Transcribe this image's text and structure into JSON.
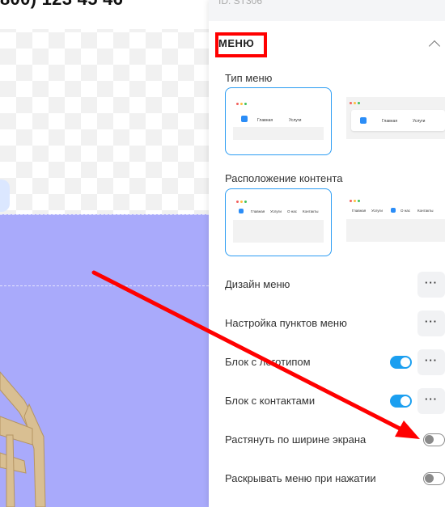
{
  "canvas": {
    "phone": "800) 123 45 46"
  },
  "panel": {
    "id_text": "ID: ST306",
    "section_title": "МЕНЮ",
    "menu_type_label": "Тип меню",
    "content_position_label": "Расположение контента",
    "thumb_menu_a": {
      "nav": [
        "Главная",
        "Услуги"
      ]
    },
    "thumb_menu_b": {
      "nav": [
        "Главная",
        "Услуги"
      ]
    },
    "thumb_content_a": {
      "nav": [
        "Главная",
        "Услуги",
        "О нас",
        "Контакты"
      ]
    },
    "thumb_content_b": {
      "nav": [
        "Главная",
        "Услуги",
        "О нас",
        "Контакты"
      ]
    },
    "rows": [
      {
        "label": "Дизайн меню",
        "control": "more"
      },
      {
        "label": "Настройка пунктов меню",
        "control": "more"
      },
      {
        "label": "Блок с логотипом",
        "control": "toggle-more",
        "enabled": true
      },
      {
        "label": "Блок с контактами",
        "control": "toggle-more",
        "enabled": true
      },
      {
        "label": "Растянуть по ширине экрана",
        "control": "toggle",
        "enabled": false
      },
      {
        "label": "Раскрывать меню при нажатии",
        "control": "toggle",
        "enabled": false
      }
    ],
    "more_glyph": "···"
  },
  "colors": {
    "accent": "#1b9ff0",
    "annotation": "#ff0000",
    "block_bg": "#a9aafb"
  },
  "icons": [
    "chevron-up-icon",
    "more-icon",
    "arrow-annotation"
  ]
}
